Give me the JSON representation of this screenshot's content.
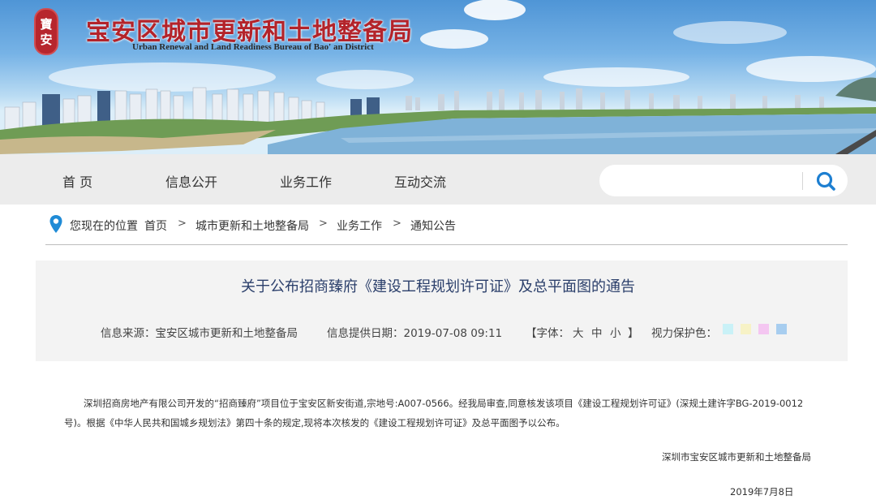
{
  "site": {
    "title_cn": "宝安区城市更新和土地整备局",
    "title_en": "Urban Renewal and Land Readiness Bureau of Bao' an District",
    "seal_text": "寶安"
  },
  "nav": {
    "items": [
      {
        "label": "首 页"
      },
      {
        "label": "信息公开"
      },
      {
        "label": "业务工作"
      },
      {
        "label": "互动交流"
      }
    ],
    "search": {
      "value": "",
      "placeholder": ""
    }
  },
  "breadcrumb": {
    "prefix": "您现在的位置",
    "items": [
      "首页",
      "城市更新和土地整备局",
      "业务工作",
      "通知公告"
    ],
    "separator": ">"
  },
  "article": {
    "title": "关于公布招商臻府《建设工程规划许可证》及总平面图的通告",
    "source": "信息来源：宝安区城市更新和土地整备局",
    "date": "信息提供日期：2019-07-08 09:11",
    "font_label": "【字体：",
    "font_sizes": [
      "大",
      "中",
      "小"
    ],
    "font_close": "】",
    "eye_label": "视力保护色：",
    "eye_colors": [
      "#c9f1f7",
      "#f7f2c6",
      "#f4c6f1",
      "#a7cdef"
    ],
    "body": "深圳招商房地产有限公司开发的“招商臻府”项目位于宝安区新安街道,宗地号:A007-0566。经我局审查,同意核发该项目《建设工程规划许可证》(深规土建许字BG-2019-0012号)。根据《中华人民共和国城乡规划法》第四十条的规定,现将本次核发的《建设工程规划许可证》及总平面图予以公布。",
    "signature": "深圳市宝安区城市更新和土地整备局",
    "sign_date": "2019年7月8日"
  },
  "colors": {
    "title_red": "#b3232a",
    "nav_bg": "#ececec",
    "pin_blue": "#1f8bd6",
    "search_blue": "#1d7fd1"
  }
}
